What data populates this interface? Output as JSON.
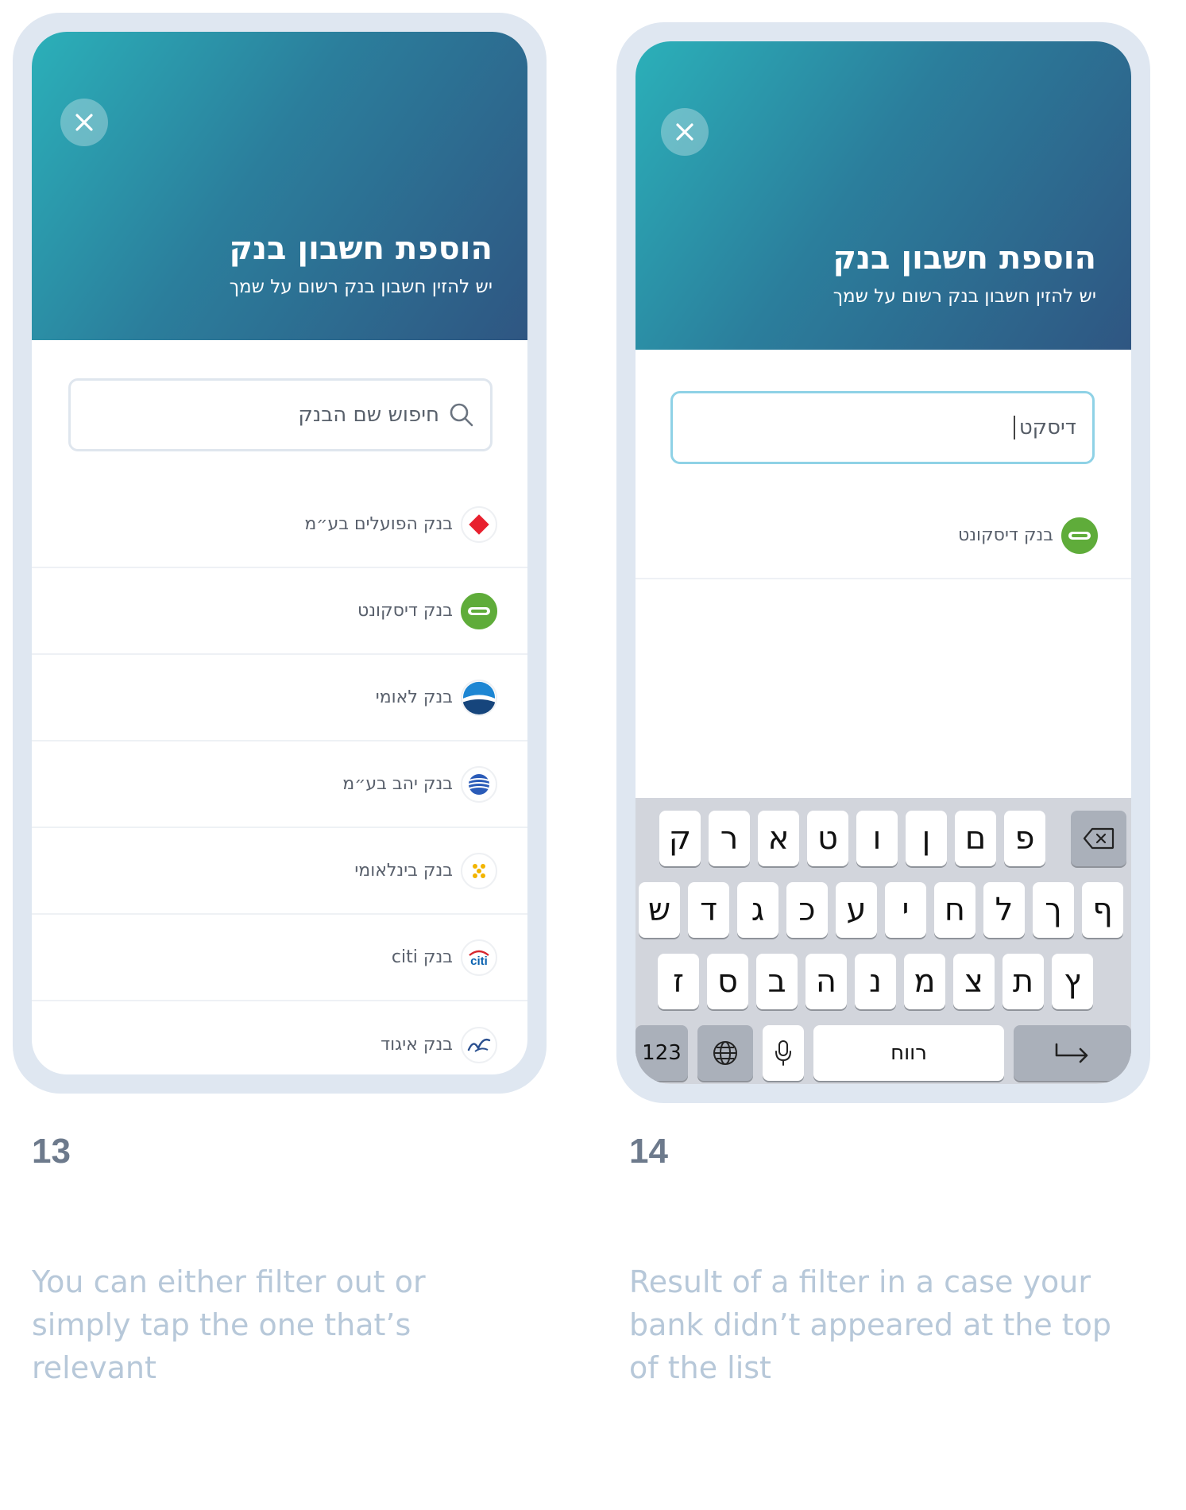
{
  "colors": {
    "frame": "#dfe7f1",
    "header_start": "#2bb0b9",
    "header_end": "#2f5682",
    "active_border": "#8fd2e6",
    "step_number": "#6d7a8c",
    "caption": "#b7c8d9"
  },
  "screen13": {
    "close_icon": "close-icon",
    "title": "הוספת חשבון בנק",
    "subtitle": "יש להזין חשבון בנק רשום על שמך",
    "search": {
      "placeholder": "חיפוש שם הבנק",
      "icon": "search-icon"
    },
    "banks": [
      {
        "label": "בנק הפועלים בע״מ",
        "icon": "hapoalim-logo-icon"
      },
      {
        "label": "בנק דיסקונט",
        "icon": "discount-logo-icon"
      },
      {
        "label": "בנק לאומי",
        "icon": "leumi-logo-icon"
      },
      {
        "label": "בנק יהב בע״מ",
        "icon": "yahav-logo-icon"
      },
      {
        "label": "בנק בינלאומי",
        "icon": "beinleumi-logo-icon"
      },
      {
        "label": "בנק citi",
        "icon": "citi-logo-icon"
      },
      {
        "label": "בנק איגוד",
        "icon": "igud-logo-icon"
      }
    ],
    "step_number": "13",
    "caption_lines": [
      "You can either filter out or",
      "simply tap the one that’s",
      "relevant"
    ]
  },
  "screen14": {
    "close_icon": "close-icon",
    "title": "הוספת חשבון בנק",
    "subtitle": "יש להזין חשבון בנק רשום על שמך",
    "search_value": "דיסקט",
    "result": {
      "label": "בנק דיסקונט",
      "icon": "discount-logo-icon"
    },
    "keyboard": {
      "row1": [
        "ק",
        "ר",
        "א",
        "ט",
        "ו",
        "ן",
        "ם",
        "פ"
      ],
      "row2": [
        "ש",
        "ד",
        "ג",
        "כ",
        "ע",
        "י",
        "ח",
        "ל",
        "ך",
        "ף"
      ],
      "row3": [
        "ז",
        "ס",
        "ב",
        "ה",
        "נ",
        "מ",
        "צ",
        "ת",
        "ץ"
      ],
      "numbers_label": "123",
      "space_label": "רווח",
      "backspace_icon": "backspace-icon",
      "globe_icon": "globe-icon",
      "mic_icon": "microphone-icon",
      "return_icon": "return-icon"
    },
    "step_number": "14",
    "caption_lines": [
      "Result of a filter in a case your",
      "bank didn’t appeared at the top",
      "of the list"
    ]
  }
}
